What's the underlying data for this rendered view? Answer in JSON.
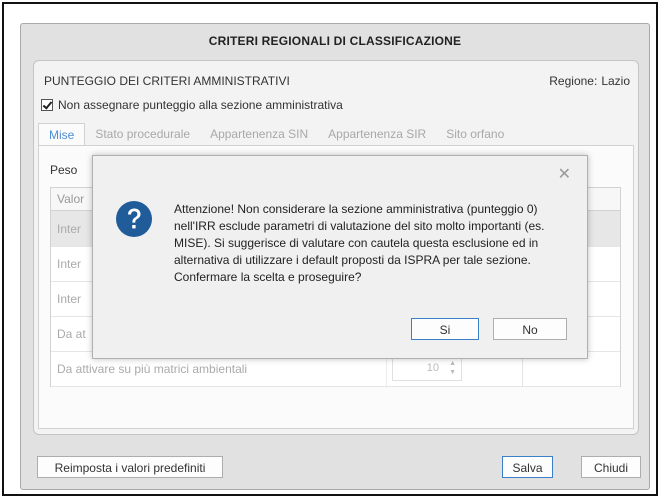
{
  "window": {
    "title": "CRITERI REGIONALI DI CLASSIFICAZIONE"
  },
  "section": {
    "title": "PUNTEGGIO DEI CRITERI AMMINISTRATIVI",
    "region_label": "Regione:",
    "region_value": "Lazio"
  },
  "checkbox": {
    "label": "Non assegnare punteggio alla sezione amministrativa",
    "checked": true
  },
  "tabs": [
    {
      "label": "Mise",
      "active": true
    },
    {
      "label": "Stato procedurale"
    },
    {
      "label": "Appartenenza SIN"
    },
    {
      "label": "Appartenenza SIR"
    },
    {
      "label": "Sito orfano"
    }
  ],
  "content": {
    "peso_label": "Peso",
    "grid_header": "Valor",
    "rows": [
      {
        "label": "Inter"
      },
      {
        "label": "Inter"
      },
      {
        "label": "Inter"
      },
      {
        "label": "Da at"
      },
      {
        "label": "Da attivare su più matrici ambientali",
        "value": "10"
      }
    ]
  },
  "footer": {
    "reset_label": "Reimposta i valori predefiniti",
    "save_label": "Salva",
    "close_label": "Chiudi"
  },
  "dialog": {
    "close_glyph": "✕",
    "icon": "question-icon",
    "lines": [
      "Attenzione! Non considerare la sezione amministrativa (punteggio 0)",
      "nell'IRR esclude parametri di valutazione del sito molto importanti (es.",
      "MISE). Si suggerisce di valutare con cautela questa esclusione ed in",
      "alternativa di utilizzare i default proposti da ISPRA per tale sezione.",
      "Confermare la scelta e proseguire?"
    ],
    "yes_label": "Si",
    "no_label": "No"
  },
  "colors": {
    "accent": "#4a8fd6",
    "icon_blue": "#1f5c99",
    "button_focus": "#3c7fc4"
  }
}
